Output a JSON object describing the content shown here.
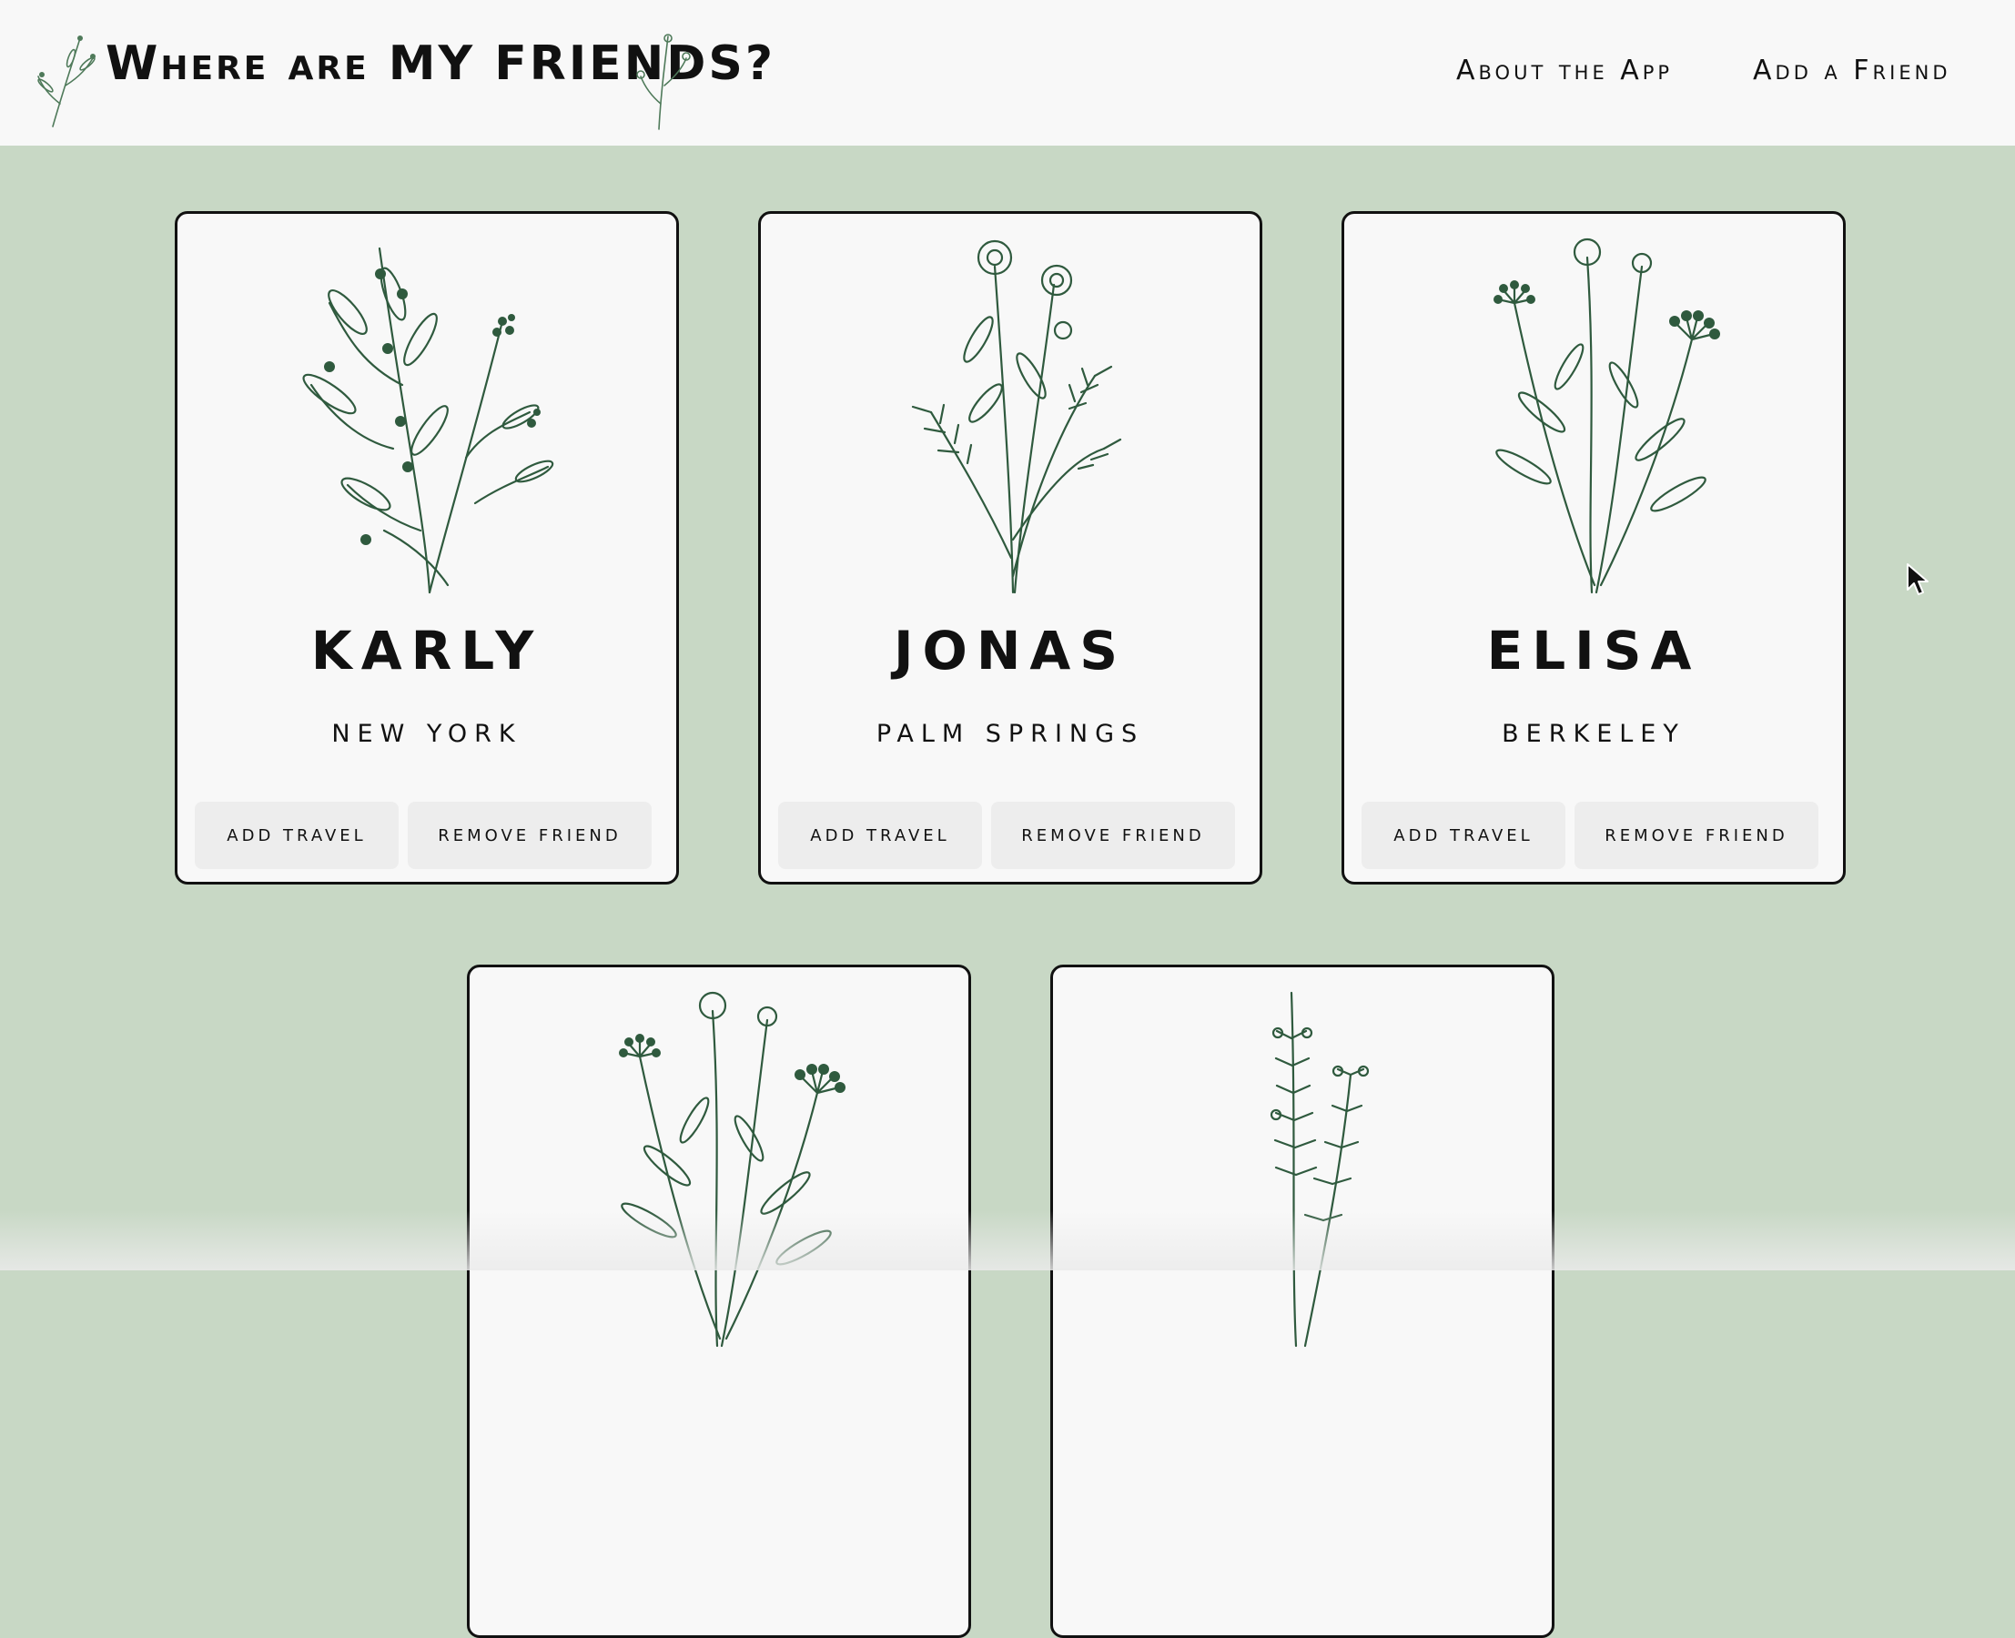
{
  "app": {
    "title": "Where are MY FRIENDS?"
  },
  "nav": {
    "about_label": "About the App",
    "add_friend_label": "Add a Friend"
  },
  "colors": {
    "page_background": "#c8d8c5",
    "surface": "#f8f8f8",
    "botanical_green": "#2f5a3e",
    "button_background": "#ededed"
  },
  "friends": [
    {
      "name": "KARLY",
      "city": "NEW YORK",
      "illustration": "olive-branch-bouquet-icon"
    },
    {
      "name": "JONAS",
      "city": "PALM SPRINGS",
      "illustration": "rose-fern-bouquet-icon"
    },
    {
      "name": "ELISA",
      "city": "BERKELEY",
      "illustration": "wildflower-bouquet-icon"
    },
    {
      "name": "",
      "city": "",
      "illustration": "wildflower-bouquet-icon"
    },
    {
      "name": "",
      "city": "",
      "illustration": "lavender-sprig-icon"
    }
  ],
  "card_actions": {
    "add_travel_label": "ADD TRAVEL",
    "remove_friend_label": "REMOVE FRIEND"
  }
}
